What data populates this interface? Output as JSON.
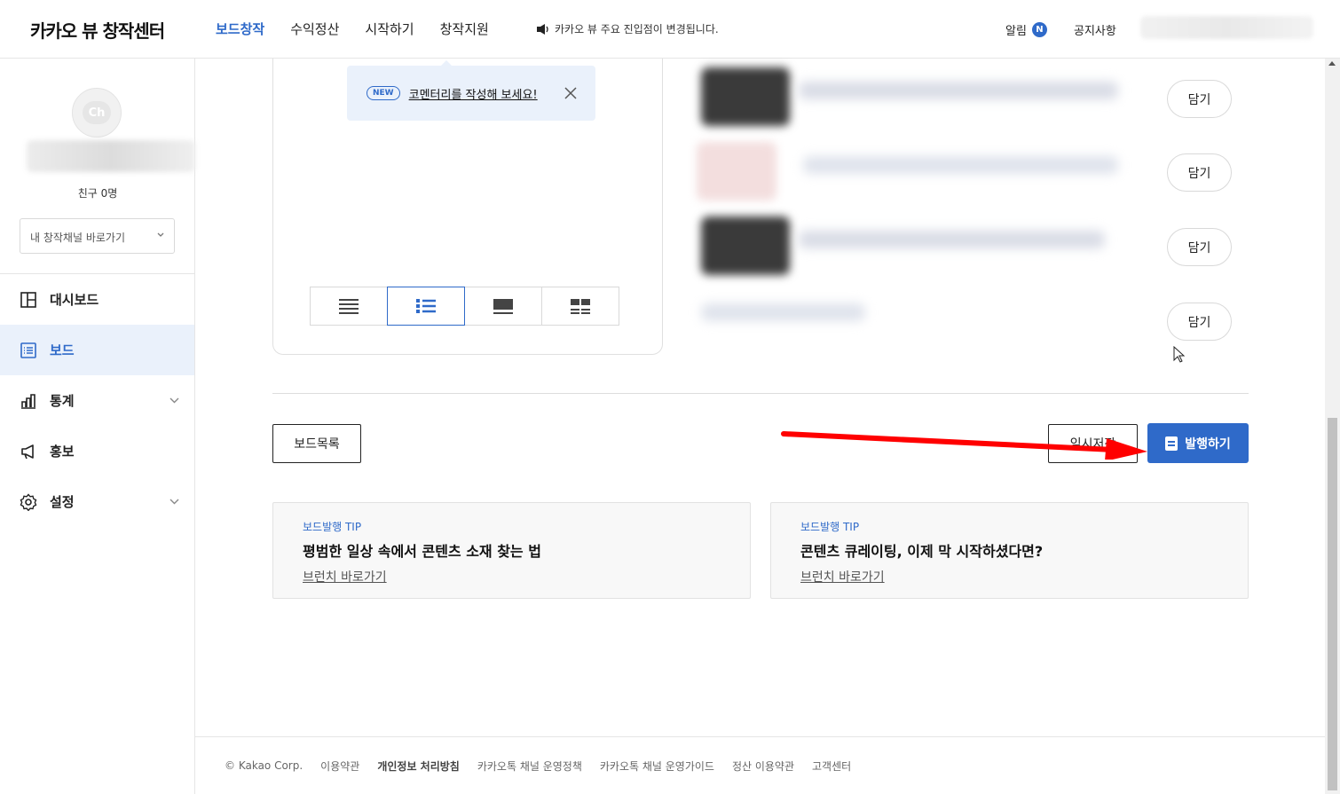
{
  "header": {
    "logo": "카카오 뷰 창작센터",
    "nav": [
      "보드창작",
      "수익정산",
      "시작하기",
      "창작지원"
    ],
    "active_nav": "보드창작",
    "notice": "카카오 뷰 주요 진입점이 변경됩니다.",
    "alarm_label": "알림",
    "alarm_badge": "N",
    "notice_link": "공지사항"
  },
  "sidebar": {
    "friends": "친구 0명",
    "channel_select": "내 창작채널 바로가기",
    "menu": [
      {
        "label": "대시보드",
        "icon": "dashboard-icon"
      },
      {
        "label": "보드",
        "icon": "board-icon",
        "active": true
      },
      {
        "label": "통계",
        "icon": "chart-icon",
        "expandable": true
      },
      {
        "label": "홍보",
        "icon": "megaphone-icon"
      },
      {
        "label": "설정",
        "icon": "gear-icon",
        "expandable": true
      }
    ]
  },
  "editor": {
    "tooltip_badge": "NEW",
    "tooltip_text": "코멘터리를 작성해 보세요!",
    "layout_options": [
      "list-layout-icon",
      "list-thumb-layout-icon",
      "card-layout-icon",
      "grid-layout-icon"
    ],
    "active_layout": 1
  },
  "content_rows": {
    "add_label": "담기"
  },
  "actions": {
    "board_list": "보드목록",
    "temp_save": "임시저장",
    "publish": "발행하기"
  },
  "tips": [
    {
      "label": "보드발행 TIP",
      "title": "평범한 일상 속에서 콘텐츠 소재 찾는 법",
      "link": "브런치 바로가기"
    },
    {
      "label": "보드발행 TIP",
      "title": "콘텐츠 큐레이팅, 이제 막 시작하셨다면?",
      "link": "브런치 바로가기"
    }
  ],
  "footer": {
    "copyright": "© Kakao Corp.",
    "links": [
      "이용약관",
      "개인정보 처리방침",
      "카카오톡 채널 운영정책",
      "카카오톡 채널 운영가이드",
      "정산 이용약관",
      "고객센터"
    ]
  },
  "colors": {
    "accent": "#2f6ac9",
    "annotation_arrow": "#ff0000"
  }
}
